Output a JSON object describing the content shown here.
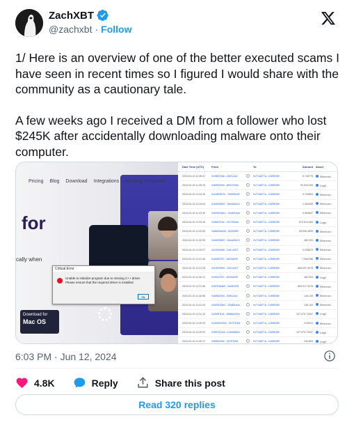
{
  "author": {
    "name": "ZachXBT",
    "handle": "@zachxbt",
    "separator": "·",
    "follow_label": "Follow",
    "verified_icon": "verified-badge-icon"
  },
  "tweet": {
    "paragraphs": [
      "1/ Here is an overview of one of the better executed scams I have seen in recent times so I figured I would share with the community as a cautionary tale.",
      "A few weeks ago I received a DM from a follower who lost $245K after accidentally downloading malware onto their computer."
    ]
  },
  "media": {
    "left": {
      "nav_items": [
        "Pricing",
        "Blog",
        "Download",
        "Integrations",
        "Meeting templates"
      ],
      "headline": "for",
      "subtext": "cally when",
      "download_line1": "Download for",
      "download_line2": "Mac OS",
      "error_title": "Critical Error",
      "error_message": "Unable to initialize program due to missing C++ driver. Please ensure that the required driver is installed.",
      "error_ok": "Ok"
    },
    "right": {
      "headers": [
        "Date Time (UTC)",
        "From",
        "",
        "To",
        "Amount",
        "Asset"
      ],
      "rows": [
        [
          "2024-04-15 11:35:47",
          "0x3f8f37fa6...2f4f7c3c4",
          "0x77a5f77a...1489f1f69",
          "0.749775",
          "Ethereum"
        ],
        [
          "2024-04-15 11:35:15",
          "0x6f5529b0...8534700fa",
          "0x77a5f77a...1489f1f69",
          "62,544,000",
          "Lingfi"
        ],
        [
          "2024-04-15 11:34:35",
          "0x1b625f7f3...7f0f4f2b4f2",
          "0x77a5f77a...1489f1f69",
          "0.720804",
          "Ethereum"
        ],
        [
          "2024-04-15 11:34:03",
          "0x6d005697...6bea06e10",
          "0x77a5f77a...1489f1f69",
          "1.300058",
          "Ethereum"
        ],
        [
          "2024-04-15 11:33:39",
          "0x8391f3be1...92a6f1ba4",
          "0x77a5f77a...1489f1f69",
          "0.993847",
          "Ethereum"
        ],
        [
          "2024-04-15 11:33:16",
          "0x9857f1be...9477f3d4a",
          "0x77a5f77a...1489f1f69",
          "872,614,563",
          "Lingfi"
        ],
        [
          "2024-04-15 11:32:53",
          "0x88d35a3f4...f1f1f0f9f0",
          "0x77a5f77a...1489f1f69",
          "55,906.4899",
          "Ethereum"
        ],
        [
          "2024-04-15 11:32:28",
          "0x6d005697...6bea06e10",
          "0x77a5f77a...1489f1f69",
          "482,903",
          "Ethereum"
        ],
        [
          "2024-04-15 11:32:07",
          "0x1f000989...7ef1c4f1f7",
          "0x77a5f77a...1489f1f69",
          "0.028679",
          "Ethereum"
        ],
        [
          "2024-04-15 11:31:49",
          "0x8d357f07...6f294699f",
          "0x77a5f77a...1489f1f69",
          "7,946,986",
          "Ethereum"
        ],
        [
          "2024-04-15 11:31:28",
          "0x1f000989...7ef1c4f1f7",
          "0x77a5f77a...1489f1f69",
          "665,057.0078",
          "Ethereum"
        ],
        [
          "2024-04-15 11:30:11",
          "0x99c27f07...6f294699f",
          "0x77a5f77a...1489f1f69",
          "482,903",
          "Lingfi"
        ],
        [
          "2024-04-15 11:31:46",
          "0x87f1f6a69...2aaf1f2f3f",
          "0x77a5f77a...1489f1f69",
          "663,917.0078",
          "Ethereum"
        ],
        [
          "2024-04-15 11:30:58",
          "0x6f5529b0...3f4f1c3c4",
          "0x77a5f77a...1489f1f69",
          "126,100",
          "Ethereum"
        ],
        [
          "2024-04-15 11:31:20",
          "0x8391f3be1...92a6f1ba4",
          "0x77a5f77a...1489f1f69",
          "126,100",
          "Ethereum"
        ],
        [
          "2024-04-15 11:31:13",
          "0x39ff7f1d1...8988b1f2bb",
          "0x77a5f77a...1489f1f69",
          "107,075.73497",
          "Lingfi"
        ],
        [
          "2024-04-15 11:30:09",
          "0x3b5394925...2b7f7f3f41",
          "0x77a5f77a...1489f1f69",
          "0.00911",
          "Ethereum"
        ],
        [
          "2024-04-15 11:30:02",
          "0x957f1f2ad...1e6f9df554",
          "0x77a5f77a...1489f1f69",
          "107,075.73497",
          "Lingfi"
        ],
        [
          "2024-04-15 11:30:17",
          "0x6f5529b0...2b7f7f3f41",
          "0x77a5f77a...1489f1f69",
          "242,800",
          "Lingfi"
        ],
        [
          "2024-04-15 11:29:47",
          "0x3f6f1a2d6...7f1f7f3f41",
          "0x77a5f77a...1489f1f69",
          "279,147.21430",
          "Lingfi"
        ],
        [
          "2024-04-15 11:29:25",
          "0x1b625f7f3...7f0f4f2b4f2",
          "0x77a5f77a...1489f1f69",
          "378,200",
          "Lingfi"
        ]
      ]
    }
  },
  "meta": {
    "timestamp": "6:03 PM · Jun 12, 2024"
  },
  "actions": {
    "likes": "4.8K",
    "reply_label": "Reply",
    "share_label": "Share this post"
  },
  "read_replies_label": "Read 320 replies",
  "colors": {
    "accent": "#1d9bf0",
    "like": "#f91880",
    "text": "#0f1419",
    "muted": "#536471"
  }
}
